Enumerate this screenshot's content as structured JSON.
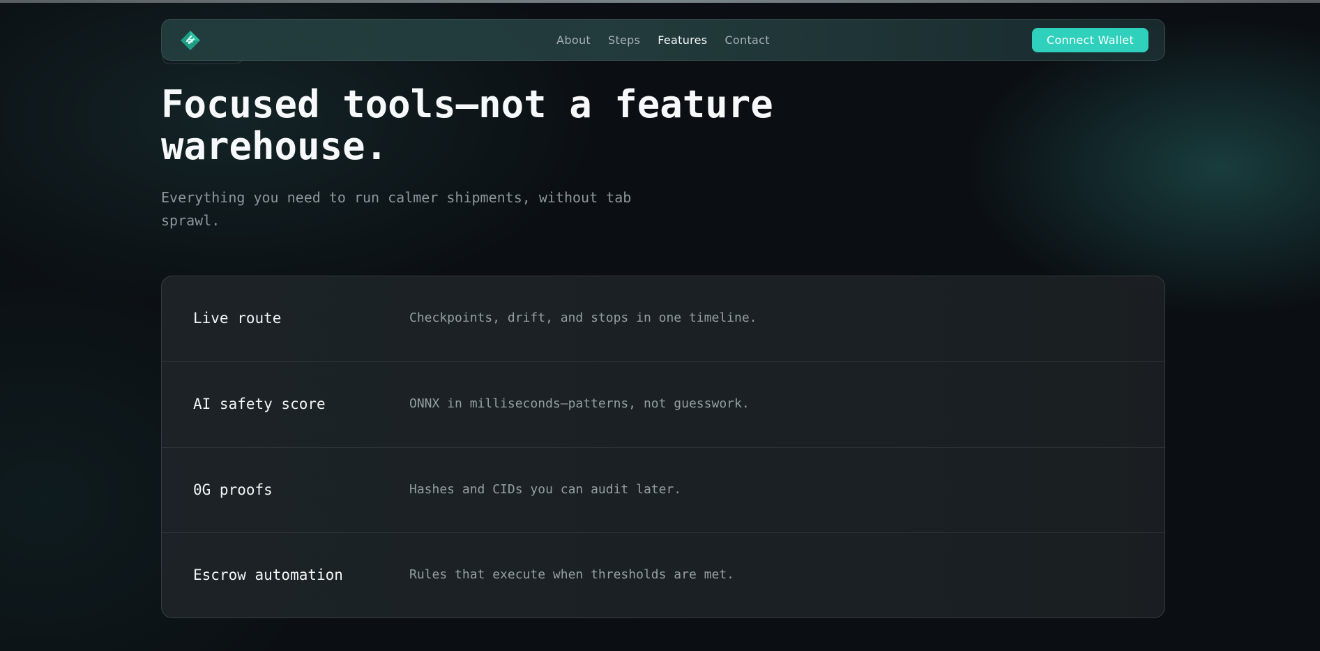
{
  "nav": {
    "logo_icon": "diamond-logo-icon",
    "links": [
      {
        "label": "About",
        "active": false
      },
      {
        "label": "Steps",
        "active": false
      },
      {
        "label": "Features",
        "active": true
      },
      {
        "label": "Contact",
        "active": false
      }
    ],
    "cta_label": "Connect Wallet",
    "accent_color": "#2fd1bd"
  },
  "hero": {
    "title": "Focused tools—not a feature warehouse.",
    "subtitle": "Everything you need to run calmer shipments, without tab sprawl."
  },
  "features": [
    {
      "title": "Live route",
      "description": "Checkpoints, drift, and stops in one timeline."
    },
    {
      "title": "AI safety score",
      "description": "ONNX in milliseconds—patterns, not guesswork."
    },
    {
      "title": "0G proofs",
      "description": "Hashes and CIDs you can audit later."
    },
    {
      "title": "Escrow automation",
      "description": "Rules that execute when thresholds are met."
    }
  ]
}
